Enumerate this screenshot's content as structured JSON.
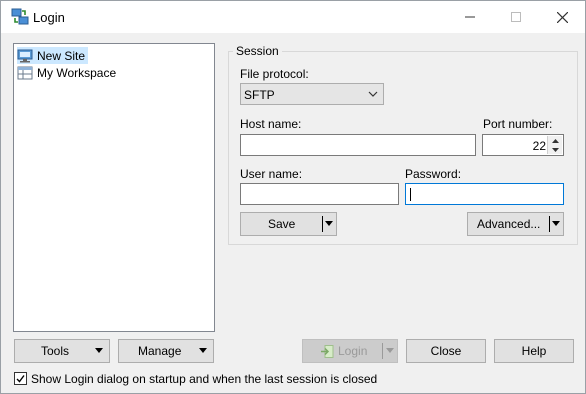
{
  "window": {
    "title": "Login",
    "app_icon": "winscp-app-icon",
    "controls": {
      "minimize": "minimize-icon",
      "maximize": "maximize-icon",
      "close": "close-icon"
    }
  },
  "site_tree": {
    "items": [
      {
        "label": "New Site",
        "icon": "new-site-icon",
        "selected": true
      },
      {
        "label": "My Workspace",
        "icon": "workspace-icon",
        "selected": false
      }
    ]
  },
  "left_buttons": {
    "tools": "Tools",
    "manage": "Manage"
  },
  "session": {
    "group_title": "Session",
    "file_protocol_label": "File protocol:",
    "file_protocol_value": "SFTP",
    "host_name_label": "Host name:",
    "host_name_value": "",
    "port_number_label": "Port number:",
    "port_number_value": "22",
    "user_name_label": "User name:",
    "user_name_value": "",
    "password_label": "Password:",
    "password_value": "",
    "save_label": "Save",
    "advanced_label": "Advanced..."
  },
  "bottom_buttons": {
    "login": "Login",
    "close": "Close",
    "help": "Help"
  },
  "checkbox": {
    "label": "Show Login dialog on startup and when the last session is closed",
    "checked": true
  },
  "colors": {
    "selection": "#cce8ff",
    "focus_border": "#0078d7",
    "background": "#f0f0f0"
  }
}
